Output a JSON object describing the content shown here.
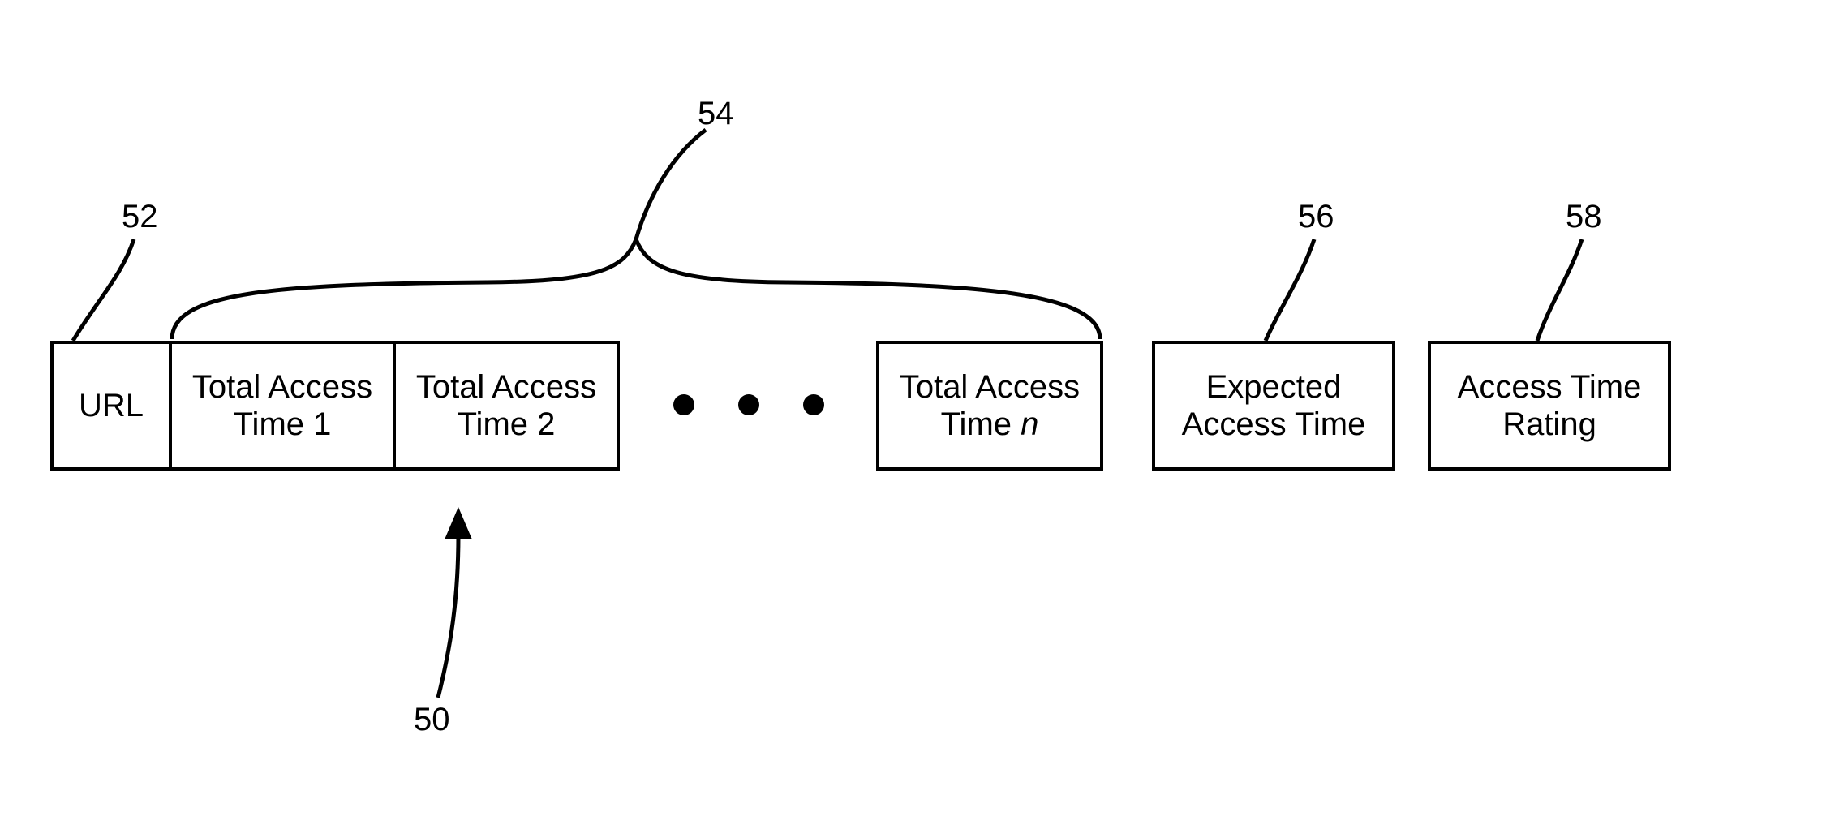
{
  "diagram": {
    "boxes": {
      "url": "URL",
      "tat1": "Total Access Time 1",
      "tat2": "Total Access Time 2",
      "tatn_prefix": "Total Access Time ",
      "tatn_suffix": "n",
      "expected": "Expected Access Time",
      "rating": "Access Time Rating"
    },
    "callouts": {
      "c50": "50",
      "c52": "52",
      "c54": "54",
      "c56": "56",
      "c58": "58"
    }
  }
}
